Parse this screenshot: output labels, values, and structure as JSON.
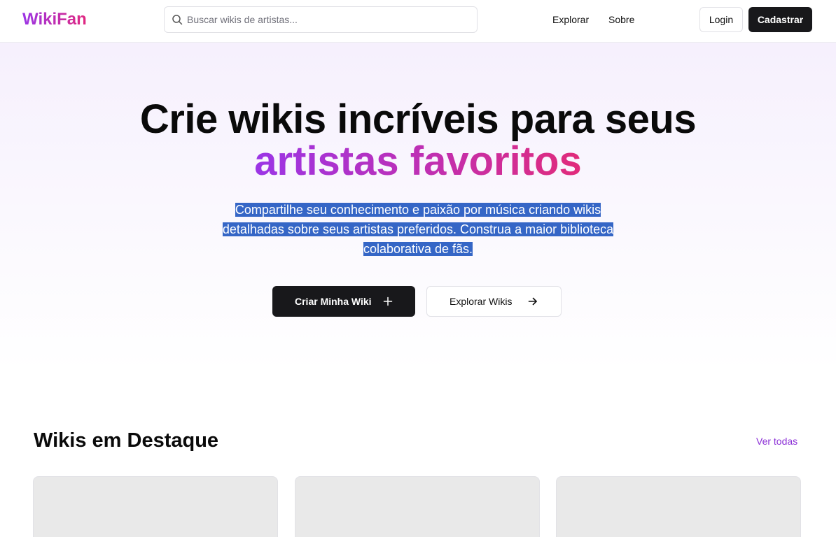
{
  "header": {
    "logo": "WikiFan",
    "search_placeholder": "Buscar wikis de artistas...",
    "nav": [
      "Explorar",
      "Sobre"
    ],
    "login": "Login",
    "signup": "Cadastrar"
  },
  "hero": {
    "title_line1": "Crie wikis incríveis para seus",
    "title_line2": "artistas favoritos",
    "subtitle_lines": [
      "Compartilhe seu conhecimento e paixão por música criando wikis",
      "detalhadas sobre seus artistas preferidos. Construa a maior biblioteca",
      "colaborativa de fãs."
    ],
    "primary_button": "Criar Minha Wiki",
    "secondary_button": "Explorar Wikis"
  },
  "featured": {
    "title": "Wikis em Destaque",
    "see_all": "Ver todas",
    "card_count": 3
  },
  "colors": {
    "brand_gradient_start": "#9b35e6",
    "brand_gradient_end": "#e1287f",
    "dark_button": "#18181b",
    "link_purple": "#8b2fd6",
    "selection_highlight": "#3566c6"
  },
  "icons": [
    "search-icon",
    "plus-icon",
    "arrow-right-icon"
  ]
}
